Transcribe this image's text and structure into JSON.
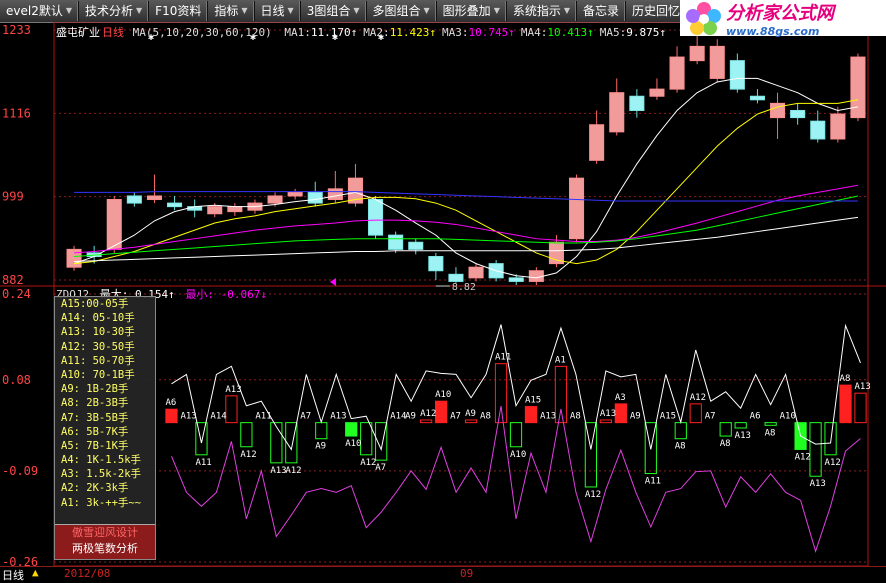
{
  "toolbar": {
    "items": [
      {
        "label": "evel2默认",
        "arrow": true
      },
      {
        "label": "技术分析",
        "arrow": true
      },
      {
        "label": "F10资料",
        "arrow": false
      },
      {
        "label": "指标",
        "arrow": true
      },
      {
        "label": "日线",
        "arrow": true
      },
      {
        "label": "3图组合",
        "arrow": true
      },
      {
        "label": "多图组合",
        "arrow": true
      },
      {
        "label": "图形叠加",
        "arrow": true
      },
      {
        "label": "系统指示",
        "arrow": true
      },
      {
        "label": "备忘录",
        "arrow": false
      },
      {
        "label": "历史回忆",
        "arrow": false
      }
    ]
  },
  "logo": {
    "title": "分析家公式网",
    "url": "www.88gs.com"
  },
  "main_chart": {
    "stock_name": "盛屯矿业",
    "period": "日线",
    "ma_params": "MA(5,10,20,30,60,120)",
    "ma_values": [
      {
        "label": "MA1:",
        "value": "11.170↑",
        "color": "#ffffff"
      },
      {
        "label": "MA2:",
        "value": "11.423↑",
        "color": "#ffff00"
      },
      {
        "label": "MA3:",
        "value": "10.745↑",
        "color": "#ff00ff"
      },
      {
        "label": "MA4:",
        "value": "10.413↑",
        "color": "#00ff00"
      },
      {
        "label": "MA5:",
        "value": "9.875↑",
        "color": "#ffffff"
      }
    ],
    "y_ticks": [
      "1233",
      "1116",
      "999",
      "882"
    ],
    "low_marker": "8.82"
  },
  "sub_chart": {
    "indicator": "ZDQJ2",
    "max_label": "最大:",
    "max_value": "0.154↑",
    "min_label": "最小:",
    "min_value": "-0.067↓",
    "y_ticks": [
      "0.24",
      "0.08",
      "-0.09",
      "-0.26"
    ],
    "legend": [
      "A15:00-05手",
      "A14: 05-10手",
      "A13: 10-30手",
      "A12: 30-50手",
      "A11: 50-70手",
      "A10: 70-1B手",
      "A9:  1B-2B手",
      "A8:  2B-3B手",
      "A7:  3B-5B手",
      "A6:  5B-7K手",
      "A5:  7B-1K手",
      "A4:  1K-1.5k手",
      "A3:  1.5k-2k手",
      "A2:  2K-3k手",
      "A1:  3k-++手~~"
    ],
    "legend_footer": [
      "傲雪迎风设计",
      "两极笔数分析"
    ]
  },
  "bottom": {
    "period": "日线",
    "dates": [
      "2012/08",
      "09"
    ]
  },
  "colors": {
    "up": "#ff4444",
    "down": "#00e0e0",
    "axis": "#b01515",
    "grid_red": "#8c1b1b"
  },
  "chart_data": [
    {
      "type": "candlestick",
      "title": "",
      "ylim": [
        882,
        1233
      ],
      "candles": [
        {
          "o": 900,
          "c": 925,
          "h": 930,
          "l": 895
        },
        {
          "o": 920,
          "c": 915,
          "h": 930,
          "l": 905
        },
        {
          "o": 925,
          "c": 995,
          "h": 1000,
          "l": 920
        },
        {
          "o": 1000,
          "c": 990,
          "h": 1005,
          "l": 985
        },
        {
          "o": 995,
          "c": 1000,
          "h": 1030,
          "l": 990
        },
        {
          "o": 990,
          "c": 985,
          "h": 1000,
          "l": 980
        },
        {
          "o": 985,
          "c": 980,
          "h": 995,
          "l": 970
        },
        {
          "o": 975,
          "c": 985,
          "h": 990,
          "l": 970
        },
        {
          "o": 978,
          "c": 985,
          "h": 990,
          "l": 972
        },
        {
          "o": 980,
          "c": 990,
          "h": 995,
          "l": 975
        },
        {
          "o": 990,
          "c": 1000,
          "h": 1005,
          "l": 985
        },
        {
          "o": 1000,
          "c": 1005,
          "h": 1010,
          "l": 995
        },
        {
          "o": 1005,
          "c": 990,
          "h": 1020,
          "l": 985
        },
        {
          "o": 995,
          "c": 1010,
          "h": 1035,
          "l": 990
        },
        {
          "o": 990,
          "c": 1025,
          "h": 1045,
          "l": 985
        },
        {
          "o": 995,
          "c": 945,
          "h": 1000,
          "l": 940
        },
        {
          "o": 945,
          "c": 925,
          "h": 950,
          "l": 920
        },
        {
          "o": 935,
          "c": 925,
          "h": 940,
          "l": 918
        },
        {
          "o": 915,
          "c": 895,
          "h": 920,
          "l": 882
        },
        {
          "o": 890,
          "c": 880,
          "h": 900,
          "l": 878
        },
        {
          "o": 885,
          "c": 900,
          "h": 905,
          "l": 880
        },
        {
          "o": 905,
          "c": 885,
          "h": 910,
          "l": 880
        },
        {
          "o": 885,
          "c": 880,
          "h": 890,
          "l": 875
        },
        {
          "o": 880,
          "c": 895,
          "h": 900,
          "l": 875
        },
        {
          "o": 905,
          "c": 935,
          "h": 945,
          "l": 900
        },
        {
          "o": 940,
          "c": 1025,
          "h": 1030,
          "l": 935
        },
        {
          "o": 1050,
          "c": 1100,
          "h": 1120,
          "l": 1045
        },
        {
          "o": 1090,
          "c": 1145,
          "h": 1165,
          "l": 1085
        },
        {
          "o": 1140,
          "c": 1120,
          "h": 1150,
          "l": 1110
        },
        {
          "o": 1140,
          "c": 1150,
          "h": 1165,
          "l": 1135
        },
        {
          "o": 1150,
          "c": 1195,
          "h": 1210,
          "l": 1145
        },
        {
          "o": 1190,
          "c": 1210,
          "h": 1225,
          "l": 1185
        },
        {
          "o": 1165,
          "c": 1210,
          "h": 1220,
          "l": 1160
        },
        {
          "o": 1190,
          "c": 1150,
          "h": 1200,
          "l": 1145
        },
        {
          "o": 1140,
          "c": 1135,
          "h": 1150,
          "l": 1130
        },
        {
          "o": 1110,
          "c": 1130,
          "h": 1145,
          "l": 1080
        },
        {
          "o": 1120,
          "c": 1110,
          "h": 1130,
          "l": 1100
        },
        {
          "o": 1105,
          "c": 1080,
          "h": 1120,
          "l": 1075
        },
        {
          "o": 1080,
          "c": 1115,
          "h": 1125,
          "l": 1075
        },
        {
          "o": 1110,
          "c": 1195,
          "h": 1200,
          "l": 1105
        }
      ],
      "series": [
        {
          "name": "MA1",
          "color": "#ffffff",
          "values": [
            905,
            915,
            930,
            945,
            965,
            978,
            985,
            987,
            985,
            985,
            988,
            992,
            995,
            1000,
            1005,
            995,
            980,
            962,
            945,
            920,
            905,
            895,
            888,
            885,
            892,
            915,
            950,
            1000,
            1045,
            1085,
            1120,
            1145,
            1160,
            1165,
            1165,
            1155,
            1145,
            1130,
            1120,
            1125
          ]
        },
        {
          "name": "MA2",
          "color": "#ffff00",
          "values": [
            905,
            908,
            915,
            922,
            932,
            942,
            952,
            962,
            968,
            972,
            978,
            982,
            986,
            990,
            995,
            998,
            998,
            996,
            990,
            980,
            965,
            950,
            935,
            920,
            910,
            905,
            910,
            925,
            950,
            980,
            1010,
            1040,
            1070,
            1095,
            1115,
            1125,
            1130,
            1130,
            1130,
            1135
          ]
        },
        {
          "name": "MA3",
          "color": "#ff00ff",
          "values": [
            920,
            922,
            925,
            928,
            932,
            936,
            940,
            944,
            948,
            952,
            955,
            958,
            960,
            962,
            965,
            966,
            966,
            965,
            963,
            960,
            955,
            950,
            945,
            940,
            938,
            936,
            936,
            938,
            942,
            948,
            955,
            962,
            970,
            978,
            986,
            994,
            1000,
            1005,
            1010,
            1015
          ]
        },
        {
          "name": "MA4",
          "color": "#00ff00",
          "values": [
            915,
            917,
            919,
            921,
            923,
            925,
            927,
            929,
            931,
            933,
            935,
            937,
            938,
            939,
            940,
            940,
            940,
            940,
            940,
            939,
            938,
            937,
            936,
            935,
            934,
            934,
            935,
            937,
            940,
            944,
            948,
            952,
            958,
            964,
            970,
            976,
            982,
            988,
            994,
            1000
          ]
        },
        {
          "name": "MA5",
          "color": "#ffffff",
          "values": [
            908,
            909,
            910,
            911,
            912,
            913,
            914,
            915,
            916,
            917,
            918,
            919,
            920,
            921,
            922,
            922,
            923,
            923,
            923,
            923,
            923,
            923,
            923,
            923,
            923,
            924,
            925,
            927,
            930,
            933,
            936,
            939,
            942,
            946,
            950,
            954,
            958,
            962,
            966,
            970
          ]
        },
        {
          "name": "MA6",
          "color": "#3333ff",
          "values": [
            1005,
            1005,
            1005,
            1005,
            1006,
            1006,
            1006,
            1006,
            1006,
            1006,
            1006,
            1006,
            1006,
            1006,
            1006,
            1005,
            1004,
            1003,
            1002,
            1001,
            1000,
            999,
            998,
            997,
            996,
            995,
            994,
            993,
            993,
            993,
            993,
            993,
            993,
            993,
            993,
            993,
            993,
            993,
            993,
            993
          ]
        }
      ]
    },
    {
      "type": "bar",
      "title": "ZDQJ2",
      "ylim": [
        -0.26,
        0.24
      ],
      "values": [
        0.025,
        0.0,
        -0.06,
        0.0,
        0.05,
        -0.045,
        0.0,
        -0.075,
        -0.075,
        0.0,
        -0.03,
        0.0,
        -0.025,
        -0.06,
        -0.07,
        0.0,
        0.0,
        0.005,
        0.04,
        0.0,
        0.005,
        0.0,
        0.11,
        -0.045,
        0.03,
        0.0,
        0.105,
        0.0,
        -0.12,
        0.005,
        0.035,
        0.0,
        -0.095,
        0.0,
        -0.03,
        0.035,
        0.0,
        -0.025,
        -0.01,
        0.0,
        -0.005,
        0.0,
        -0.05,
        -0.1,
        -0.06,
        0.07,
        0.055
      ],
      "labels": [
        "A6",
        "A13",
        "A11",
        "A14",
        "A13",
        "A12",
        "A11",
        "A13",
        "A12",
        "A7",
        "A9",
        "A13",
        "A10",
        "A12",
        "A7",
        "A14",
        "A9",
        "A12",
        "A10",
        "A7",
        "A9",
        "A8",
        "A11",
        "A10",
        "A15",
        "A13",
        "A1",
        "A8",
        "A12",
        "A13",
        "A3",
        "A9",
        "A11",
        "A15",
        "A8",
        "A12",
        "A7",
        "A8",
        "A13",
        "A6",
        "A8",
        "A10",
        "A12",
        "A13",
        "A12",
        "A8",
        "A13"
      ]
    }
  ]
}
